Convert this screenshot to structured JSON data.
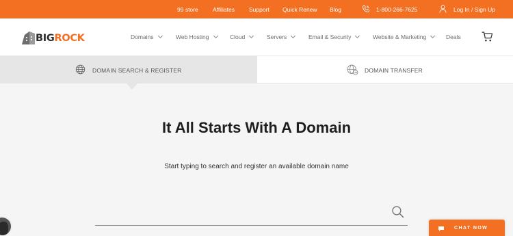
{
  "topbar": {
    "links": [
      "99 store",
      "Affiliates",
      "Support",
      "Quick Renew",
      "Blog"
    ],
    "phone": "1-800-266-7625",
    "login": "Log In / Sign Up",
    "phone_icon": "phone-icon",
    "user_icon": "user-icon"
  },
  "brand": {
    "big": "BIG",
    "rock": "ROCK",
    "accent": "#f36f21"
  },
  "nav": {
    "items": [
      "Domains",
      "Web Hosting",
      "Cloud",
      "Servers",
      "Email & Security",
      "Website & Marketing",
      "Deals"
    ],
    "cart_icon": "cart-icon"
  },
  "tabs": {
    "search": "DOMAIN SEARCH & REGISTER",
    "transfer": "DOMAIN TRANSFER",
    "search_icon": "globe-icon",
    "transfer_icon": "globe-transfer-icon"
  },
  "hero": {
    "title": "It All Starts With A Domain",
    "subtitle": "Start typing to search and register an available domain name"
  },
  "search": {
    "value": "",
    "placeholder": ""
  },
  "chat": {
    "label": "CHAT NOW",
    "icon": "chat-bubble-icon"
  }
}
